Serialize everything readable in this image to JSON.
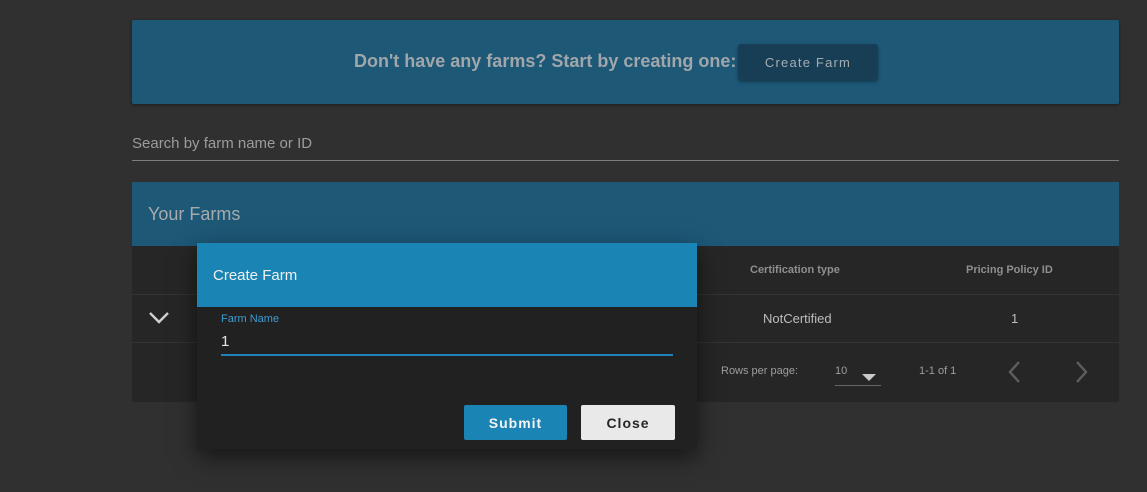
{
  "banner": {
    "text": "Don't have any farms? Start by creating one:",
    "button_label": "Create Farm"
  },
  "search": {
    "placeholder": "Search by farm name or ID"
  },
  "farms_panel": {
    "title": "Your Farms",
    "columns": [
      "Certification type",
      "Pricing Policy ID"
    ],
    "rows": [
      {
        "certification_type": "NotCertified",
        "pricing_policy_id": "1"
      }
    ],
    "footer": {
      "rows_per_page_label": "Rows per page:",
      "rows_per_page_value": "10",
      "range_text": "1-1 of 1"
    }
  },
  "dialog": {
    "title": "Create Farm",
    "field_label": "Farm Name",
    "field_value": "1",
    "submit_label": "Submit",
    "close_label": "Close"
  },
  "colors": {
    "accent": "#1a84b4",
    "banner_bg": "#1d5877",
    "background": "#303030"
  },
  "icons": {
    "expand_row": "chevron-down-icon",
    "rows_dropdown": "caret-down-icon",
    "prev_page": "chevron-left-icon",
    "next_page": "chevron-right-icon"
  }
}
